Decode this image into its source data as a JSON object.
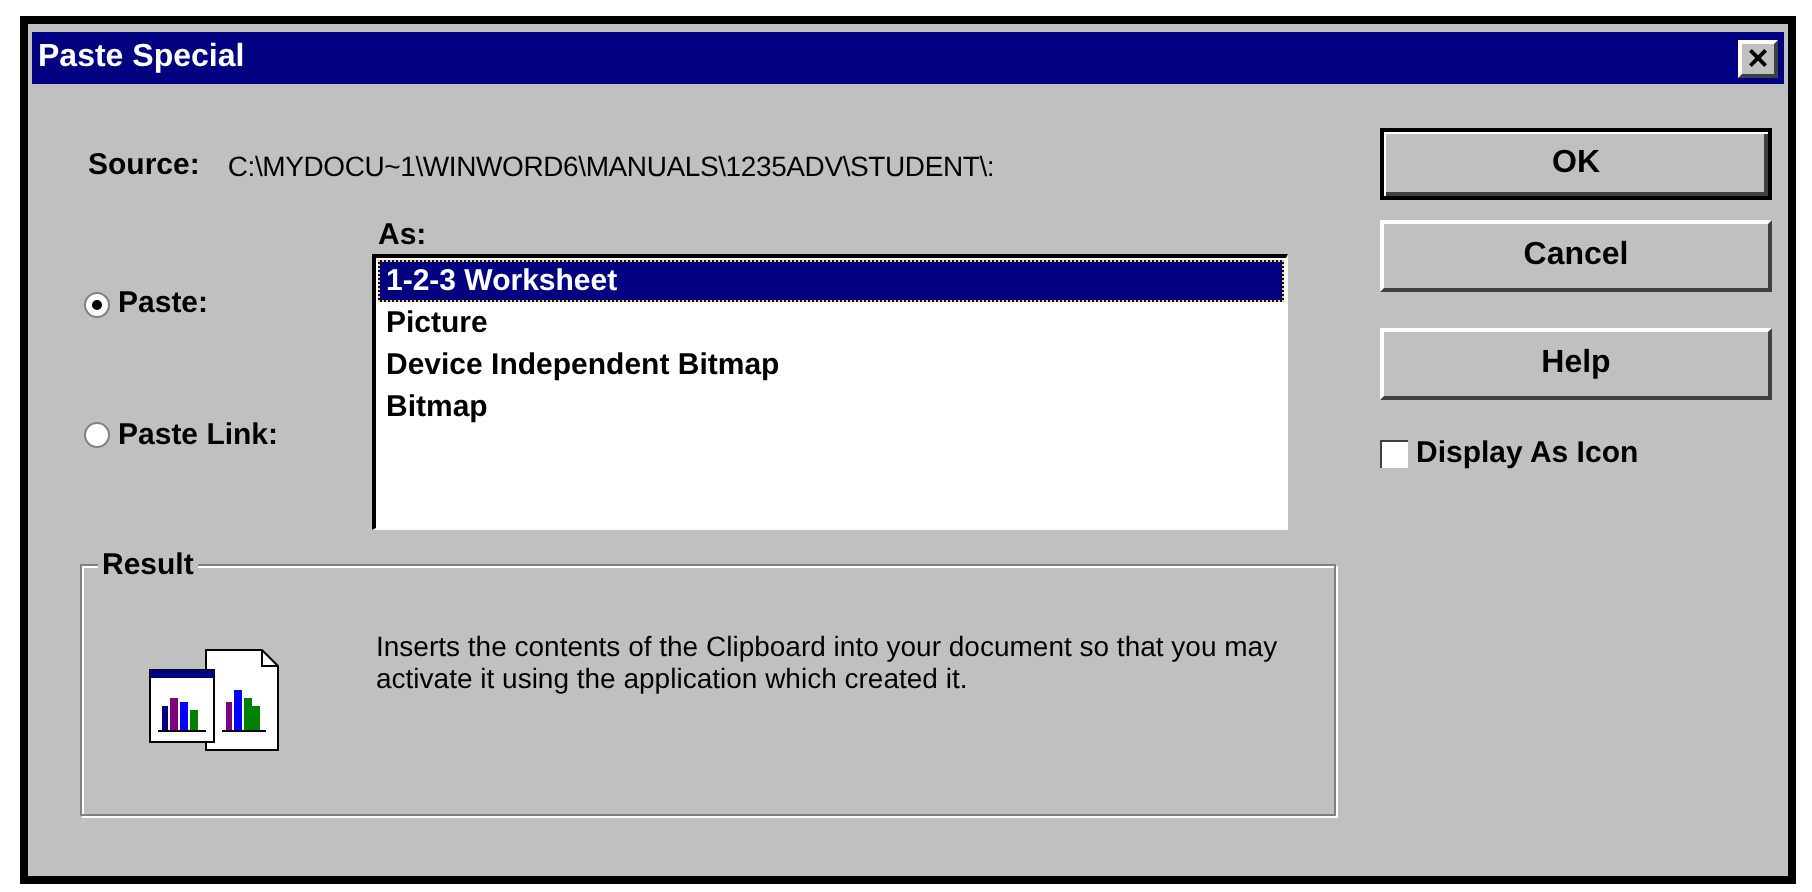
{
  "window": {
    "title": "Paste Special",
    "close": "×"
  },
  "source": {
    "label": "Source:",
    "value": "C:\\MYDOCU~1\\WINWORD6\\MANUALS\\1235ADV\\STUDENT\\:"
  },
  "options": [
    {
      "label": "Paste:",
      "selected": true
    },
    {
      "label": "Paste Link:",
      "selected": false
    }
  ],
  "as_list": {
    "label": "As:",
    "items": [
      {
        "label": "1-2-3 Worksheet",
        "selected": true
      },
      {
        "label": "Picture",
        "selected": false
      },
      {
        "label": "Device Independent Bitmap",
        "selected": false
      },
      {
        "label": "Bitmap",
        "selected": false
      }
    ]
  },
  "buttons": [
    {
      "label": "OK",
      "default": true
    },
    {
      "label": "Cancel",
      "default": false
    },
    {
      "label": "Help",
      "default": false
    }
  ],
  "display_as_icon": {
    "label": "Display As Icon",
    "checked": false
  },
  "result": {
    "title": "Result",
    "text": "Inserts the contents of the Clipboard into your document so that you may activate it using the application which created it."
  }
}
